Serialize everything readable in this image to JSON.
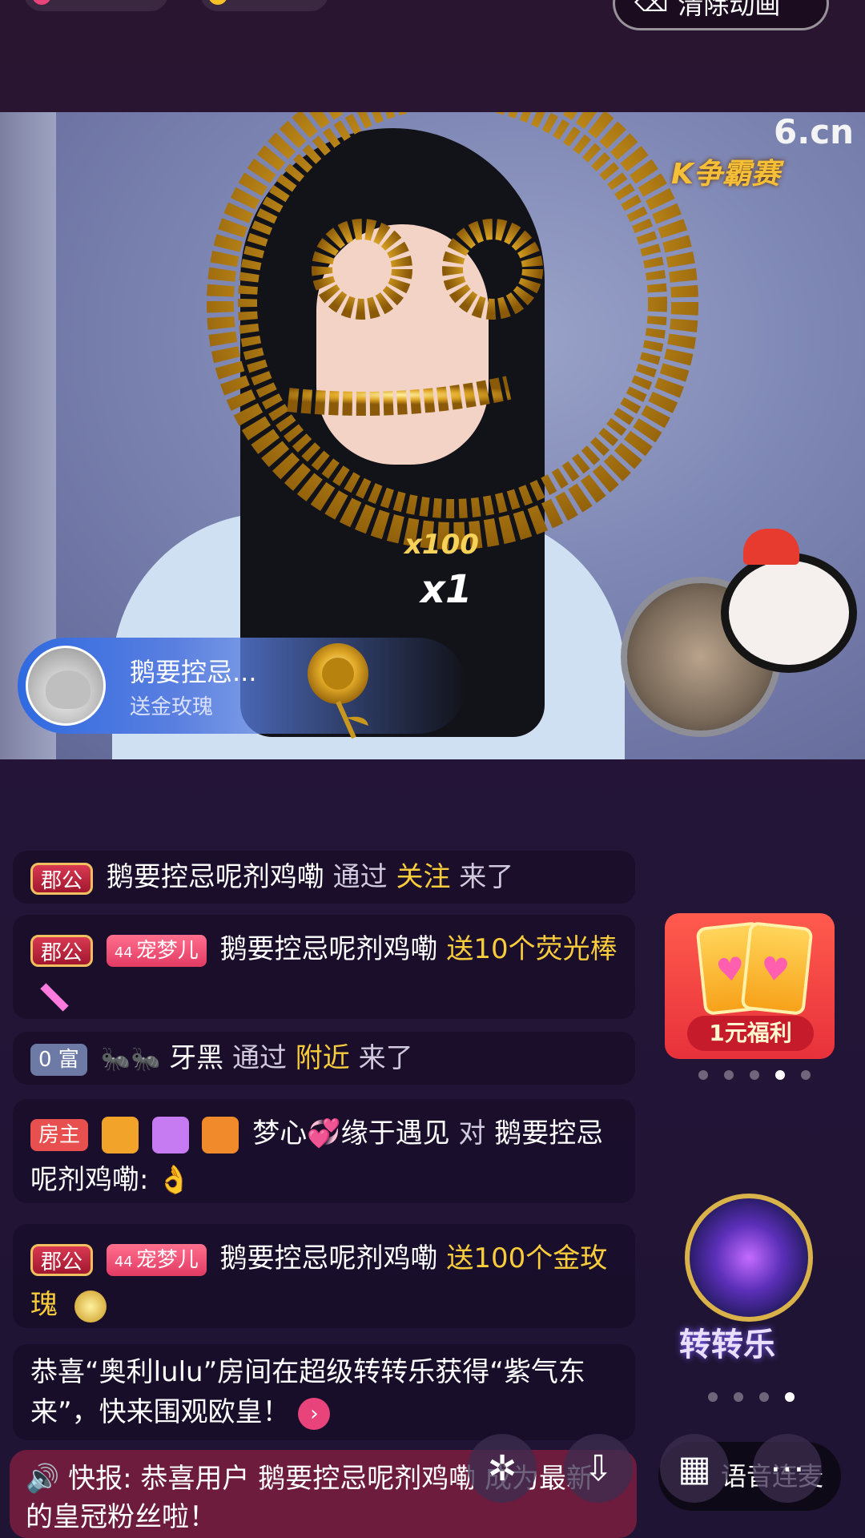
{
  "top": {
    "clear_animation_label": "清除动画"
  },
  "video": {
    "brand_logo": "6.cn",
    "banner_text": "K争霸赛"
  },
  "gift_bar": {
    "sender_name": "鹅要控忌...",
    "action": "送金玫瑰",
    "combo_total": "x100",
    "combo_count": "x1"
  },
  "chat": {
    "messages": [
      {
        "badge": "郡公",
        "name": "鹅要控忌呢剂鸡嘞",
        "verb": "通过",
        "source": "关注",
        "tail": "来了"
      },
      {
        "badge": "郡公",
        "level": "44",
        "pet_badge": "宠梦儿",
        "name": "鹅要控忌呢剂鸡嘞",
        "gift_text": "送10个荧光棒"
      },
      {
        "rich_badge": "0 富",
        "name": "牙黑",
        "verb": "通过",
        "source": "附近",
        "tail": "来了"
      },
      {
        "host_badge": "房主",
        "name": "梦心💞缘于遇见",
        "to": "对",
        "target": "鹅要控忌呢剂鸡嘞:",
        "emoji": "👌"
      },
      {
        "badge": "郡公",
        "level": "44",
        "pet_badge": "宠梦儿",
        "name": "鹅要控忌呢剂鸡嘞",
        "gift_text": "送100个金玫瑰"
      },
      {
        "system_text": "恭喜“奥利lulu”房间在超级转转乐获得“紫气东来”，快来围观欧皇！"
      }
    ],
    "news_flash": "快报: 恭喜用户 鹅要控忌呢剂鸡嘞 成为最新的皇冠粉丝啦！"
  },
  "side": {
    "welfare_label": "1元福利",
    "spin_label": "转转乐"
  },
  "bottom": {
    "voice_label": "语音连麦"
  },
  "colors": {
    "highlight": "#f9cc3b",
    "accent": "#e8437a"
  }
}
